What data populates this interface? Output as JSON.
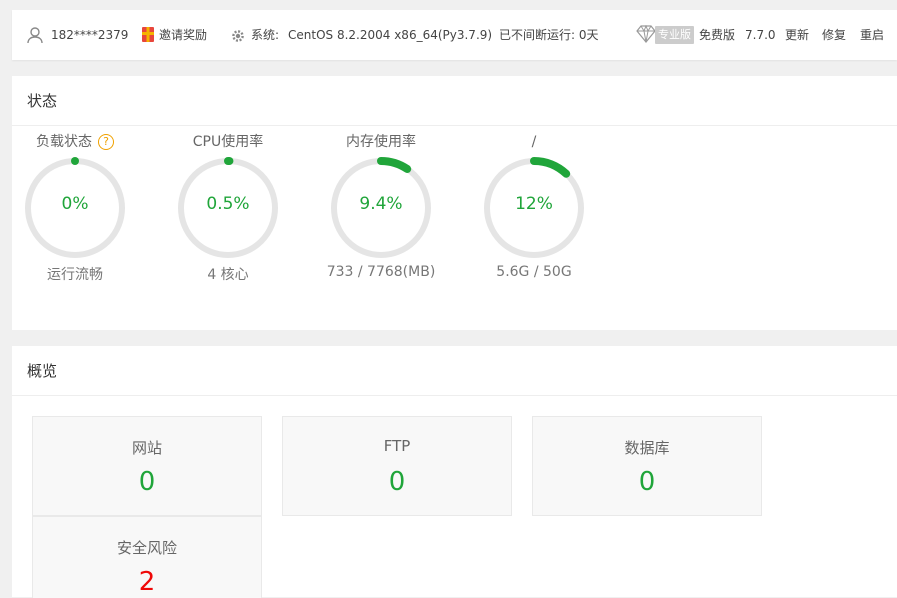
{
  "topbar": {
    "username": "182****2379",
    "invite_label": "邀请奖励",
    "system_label": "系统:",
    "system_value": "CentOS 8.2.2004 x86_64(Py3.7.9)",
    "uptime": "已不间断运行: 0天",
    "pro_badge": "专业版",
    "edition": "免费版",
    "version": "7.7.0",
    "update_label": "更新",
    "repair_label": "修复",
    "restart_label": "重启"
  },
  "status_panel": {
    "title": "状态",
    "help_glyph": "?",
    "gauges": [
      {
        "title": "负载状态",
        "value_text": "0%",
        "percent": 0,
        "sub": "运行流畅",
        "has_help": true
      },
      {
        "title": "CPU使用率",
        "value_text": "0.5%",
        "percent": 0.5,
        "sub": "4 核心"
      },
      {
        "title": "内存使用率",
        "value_text": "9.4%",
        "percent": 9.4,
        "sub": "733 / 7768(MB)"
      },
      {
        "title": "/",
        "value_text": "12%",
        "percent": 12,
        "sub": "5.6G / 50G"
      }
    ]
  },
  "overview_panel": {
    "title": "概览",
    "cards": [
      {
        "label": "网站",
        "value": "0"
      },
      {
        "label": "FTP",
        "value": "0"
      },
      {
        "label": "数据库",
        "value": "0"
      },
      {
        "label": "安全风险",
        "value": "2"
      }
    ]
  },
  "colors": {
    "accent": "#20a53a",
    "danger": "#ef0808",
    "track": "#e5e5e5",
    "warning": "#f0a100"
  }
}
